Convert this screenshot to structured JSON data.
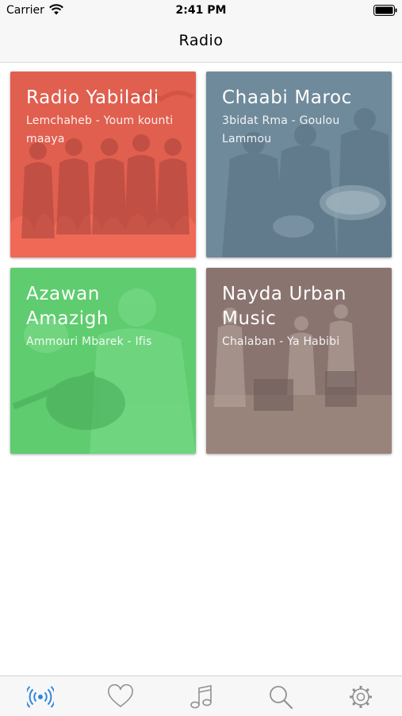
{
  "status_bar": {
    "carrier": "Carrier",
    "time": "2:41 PM"
  },
  "nav": {
    "title": "Radio"
  },
  "stations": [
    {
      "name": "Radio Yabiladi",
      "now_playing": "Lemchaheb - Youm kounti maaya",
      "color": "#e06050"
    },
    {
      "name": "Chaabi Maroc",
      "now_playing": "3bidat Rma - Goulou Lammou",
      "color": "#6f8a9c"
    },
    {
      "name": "Azawan Amazigh",
      "now_playing": "Ammouri Mbarek - Ifis",
      "color": "#5ecb6e"
    },
    {
      "name": "Nayda Urban Music",
      "now_playing": "Chalaban - Ya Habibi",
      "color": "#8a7470"
    }
  ],
  "tabs": [
    {
      "icon": "radio-icon",
      "active": true
    },
    {
      "icon": "heart-icon",
      "active": false
    },
    {
      "icon": "music-note-icon",
      "active": false
    },
    {
      "icon": "search-icon",
      "active": false
    },
    {
      "icon": "settings-gear-icon",
      "active": false
    }
  ],
  "colors": {
    "accent": "#2f86e0",
    "inactive": "#929292"
  }
}
